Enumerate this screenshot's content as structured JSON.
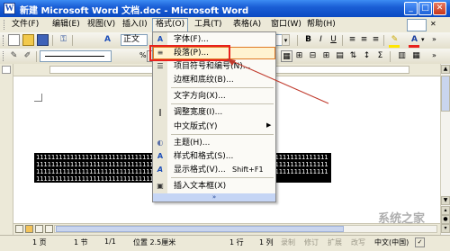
{
  "window": {
    "title": "新建 Microsoft Word 文档.doc - Microsoft Word",
    "minimize": "_",
    "maximize": "□",
    "close": "✕"
  },
  "menubar": {
    "items": [
      "文件(F)",
      "编辑(E)",
      "视图(V)",
      "插入(I)",
      "格式(O)",
      "工具(T)",
      "表格(A)",
      "窗口(W)",
      "帮助(H)"
    ]
  },
  "toolbar1": {
    "style_value": "正文",
    "font_value": "B",
    "bold": "B",
    "italic": "I",
    "underline": "U",
    "font_color": "A"
  },
  "toolbar2": {
    "percent_label": "%"
  },
  "format_menu": {
    "items": [
      {
        "label": "字体(F)...",
        "icon": "font-icon",
        "glyph": "A"
      },
      {
        "label": "段落(P)...",
        "icon": "paragraph-icon",
        "glyph": "≡"
      },
      {
        "label": "项目符号和编号(N)...",
        "icon": "bullets-icon",
        "glyph": "☰"
      },
      {
        "label": "边框和底纹(B)...",
        "icon": "borders-icon",
        "glyph": ""
      },
      {
        "label": "文字方向(X)...",
        "icon": "text-direction-icon",
        "glyph": ""
      },
      {
        "label": "调整宽度(I)...",
        "icon": "adjust-width-icon",
        "glyph": "‖"
      },
      {
        "label": "中文版式(Y)",
        "icon": "",
        "glyph": "",
        "submenu": "▶"
      },
      {
        "label": "主题(H)...",
        "icon": "theme-icon",
        "glyph": "◐"
      },
      {
        "label": "样式和格式(S)...",
        "icon": "styles-icon",
        "glyph": "A"
      },
      {
        "label": "显示格式(V)...",
        "icon": "reveal-format-icon",
        "glyph": "A",
        "shortcut": "Shift+F1"
      },
      {
        "label": "插入文本框(X)",
        "icon": "textbox-icon",
        "glyph": "▣"
      }
    ],
    "expand_glyph": "»"
  },
  "document": {
    "selected_text": "11111111111111111111111111111111111111111111111111111111111111111111111111111111111111111111111111111111111111111111111111111111111111111111111111111111111111111111111111111111111111111111111111111111111111111111111111111111111111111111111111111111111111111111111111111111"
  },
  "statusbar": {
    "page": "1 页",
    "section": "1 节",
    "pages": "1/1",
    "position": "位置 2.5厘米",
    "line": "1 行",
    "column": "1 列",
    "rec": "录制",
    "trk": "修订",
    "ext": "扩展",
    "ovr": "改写",
    "language": "中文(中国)"
  },
  "watermark": "系统之家",
  "colors": {
    "titlebar": "#0a49c2",
    "highlight_border": "#e8211d",
    "menu_hover": "#fff3d0"
  }
}
